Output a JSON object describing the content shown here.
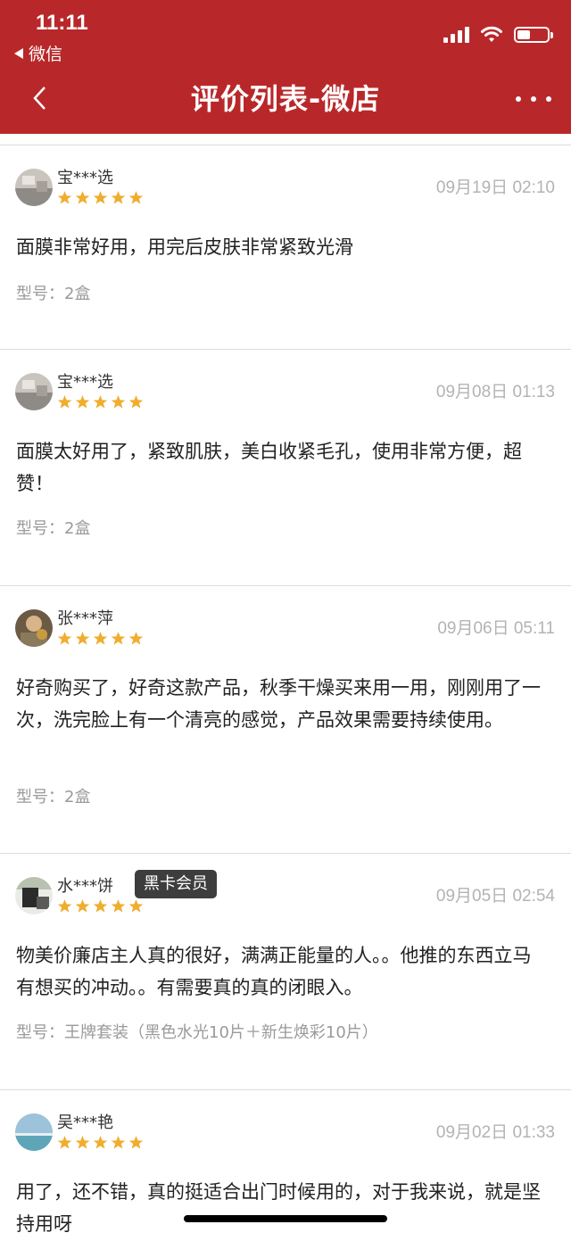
{
  "status_bar": {
    "time": "11:11",
    "back_label": "微信"
  },
  "nav": {
    "title": "评价列表-微店"
  },
  "colors": {
    "brand": "#b8282a",
    "star": "#f0ad2e",
    "badge_bg": "#3d3d3d"
  },
  "reviews": [
    {
      "user": "宝***选",
      "date": "09月19日 02:10",
      "rating": 5,
      "content": "面膜非常好用，用完后皮肤非常紧致光滑",
      "spec": "型号：2盒"
    },
    {
      "user": "宝***选",
      "date": "09月08日 01:13",
      "rating": 5,
      "content": "面膜太好用了，紧致肌肤，美白收紧毛孔，使用非常方便，超赞！",
      "spec": "型号：2盒"
    },
    {
      "user": "张***萍",
      "date": "09月06日 05:11",
      "rating": 5,
      "content": "好奇购买了，好奇这款产品，秋季干燥买来用一用，刚刚用了一次，洗完脸上有一个清亮的感觉，产品效果需要持续使用。",
      "spec": "型号：2盒"
    },
    {
      "user": "水***饼",
      "badge": "黑卡会员",
      "date": "09月05日 02:54",
      "rating": 5,
      "content": "物美价廉店主人真的很好，满满正能量的人。。他推的东西立马有想买的冲动。。有需要真的真的闭眼入。",
      "spec": "型号：王牌套装（黑色水光10片＋新生焕彩10片）"
    },
    {
      "user": "吴***艳",
      "date": "09月02日 01:33",
      "rating": 5,
      "content": "用了，还不错，真的挺适合出门时候用的，对于我来说，就是坚持用呀",
      "spec": ""
    }
  ]
}
